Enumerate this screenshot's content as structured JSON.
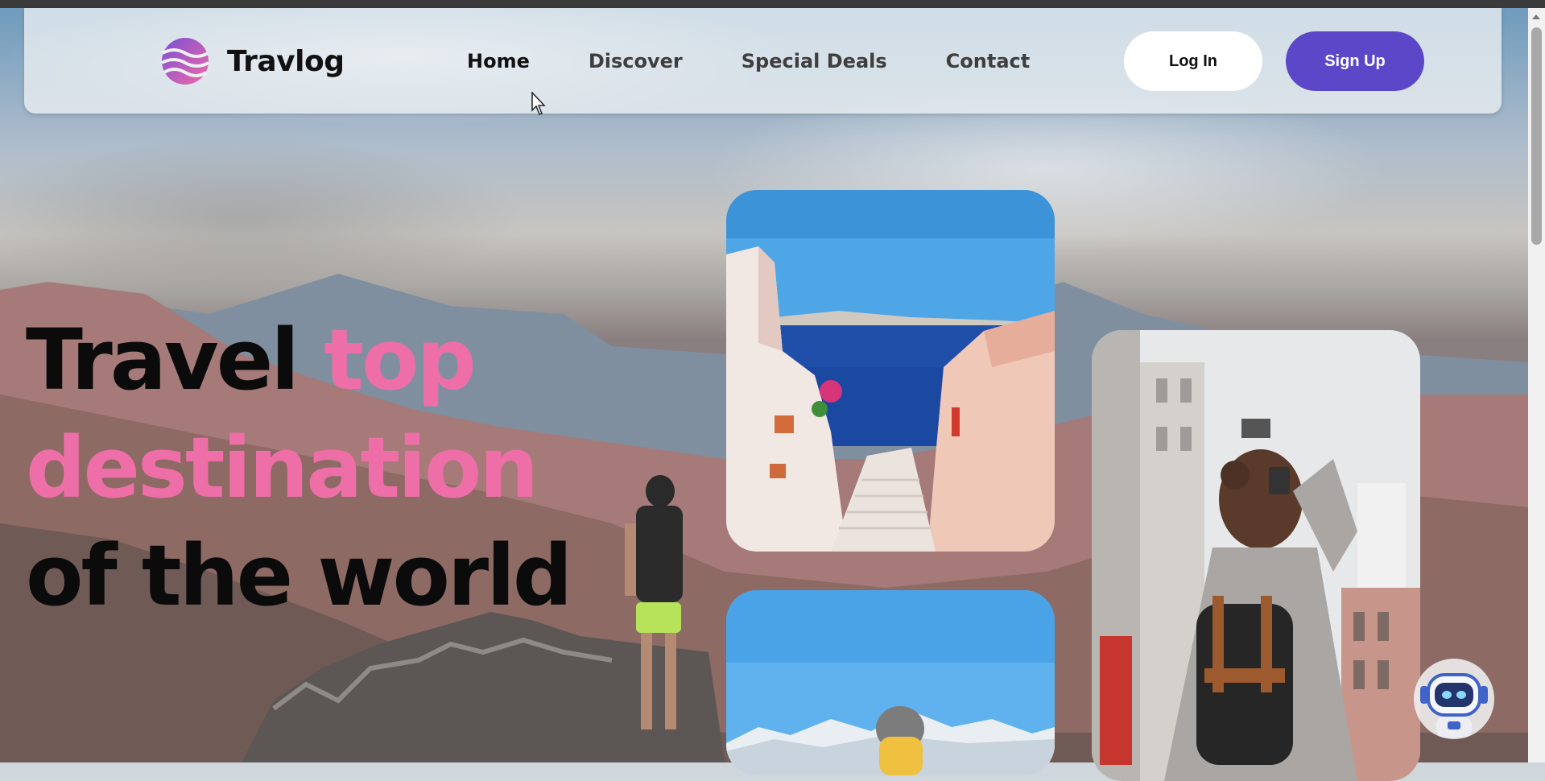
{
  "brand": {
    "name": "Travlog"
  },
  "nav": {
    "items": [
      {
        "label": "Home",
        "active": true
      },
      {
        "label": "Discover",
        "active": false
      },
      {
        "label": "Special Deals",
        "active": false
      },
      {
        "label": "Contact",
        "active": false
      }
    ],
    "login_label": "Log In",
    "signup_label": "Sign Up"
  },
  "hero": {
    "headline_parts": {
      "part1": "Travel ",
      "part2": "top destination",
      "part3": " of the world"
    },
    "subtext": ""
  },
  "colors": {
    "accent_pink": "#ee6fa8",
    "signup_purple": "#5b47c7",
    "headline_dark": "#0b0b0b"
  },
  "icons": {
    "logo": "travlog-logo-icon",
    "chatbot": "robot-assistant-icon",
    "cursor": "mouse-pointer-icon"
  }
}
